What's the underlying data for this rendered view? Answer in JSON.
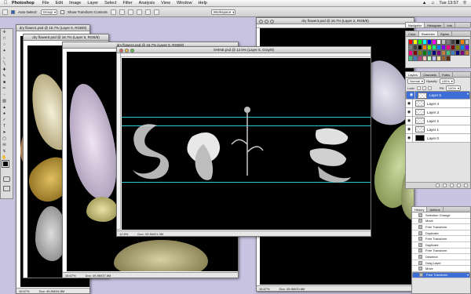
{
  "menubar": {
    "app": "Photoshop",
    "items": [
      "File",
      "Edit",
      "Image",
      "Layer",
      "Select",
      "Filter",
      "Analysis",
      "View",
      "Window",
      "Help"
    ],
    "clock": "Tue 13:57"
  },
  "optbar": {
    "auto_select": "Auto-Select:",
    "auto_select_value": "Group",
    "transform_controls": "Show Transform Controls",
    "workspace": "Workspace"
  },
  "windows": {
    "w1": {
      "title": "dry flower1.psd @ 16.7% (Layer 6, RGB/8)"
    },
    "w2": {
      "title": "dry flower5.psd @ 16.7% (Layer 5, RGB/8)"
    },
    "w3": {
      "title": "dry flower4.psd @ 16.7% (Layer 5, RGB/8)",
      "zoom": "16.67%",
      "doc": "Doc: 49.8M/37.6M"
    },
    "main": {
      "title": "SHINE.psd @ 12.5% (Layer 5, Gray/8)",
      "zoom": "12.5%",
      "doc": "Doc: 33.3M/21.3M"
    },
    "back": {
      "title": "dry flower3.psd @ 16.7% (Layer 2, RGB/8)",
      "zoom": "16.67%",
      "doc": "Doc: 49.8M/33.8M"
    },
    "w1status": {
      "zoom": "16.67%",
      "doc": "Doc: 49.8M/34.8M"
    }
  },
  "panels": {
    "color_tabs": [
      "Color",
      "Swatches",
      "Styles"
    ],
    "nav_tabs": [
      "Navigator",
      "Histogram",
      "Info"
    ],
    "layer_tabs": [
      "Layers",
      "Channels",
      "Paths"
    ],
    "blend_mode": "Normal",
    "opacity_label": "Opacity:",
    "opacity": "100%",
    "lock_label": "Lock:",
    "fill_label": "Fill:",
    "fill": "100%",
    "layers": [
      "Layer 5",
      "Layer 4",
      "Layer 3",
      "Layer 2",
      "Layer 1",
      "Layer 0"
    ],
    "history_tabs": [
      "History",
      "Actions"
    ],
    "history": [
      "Selection Change",
      "Move",
      "Free Transform",
      "Duplicate",
      "Free Transform",
      "Duplicate",
      "Free Transform",
      "Deselect",
      "Drag Layer",
      "Move",
      "Free Transform"
    ]
  },
  "swatch_colors": [
    "#ff0000",
    "#ffff00",
    "#00ff00",
    "#00ffff",
    "#0000ff",
    "#ff00ff",
    "#ffffff",
    "#c0c0c0",
    "#808080",
    "#404040",
    "#000000",
    "#ff8000",
    "#80ff00",
    "#00ff80",
    "#0080ff",
    "#8000ff",
    "#ff0080",
    "#800000",
    "#808000",
    "#008000",
    "#008080",
    "#000080",
    "#800080",
    "#c08040",
    "#40c080",
    "#4080c0",
    "#c04080",
    "#ffc0c0",
    "#c0ffc0",
    "#c0c0ff",
    "#f0e0a0",
    "#a06030",
    "#603010",
    "#306090",
    "#903060",
    "#609030"
  ]
}
